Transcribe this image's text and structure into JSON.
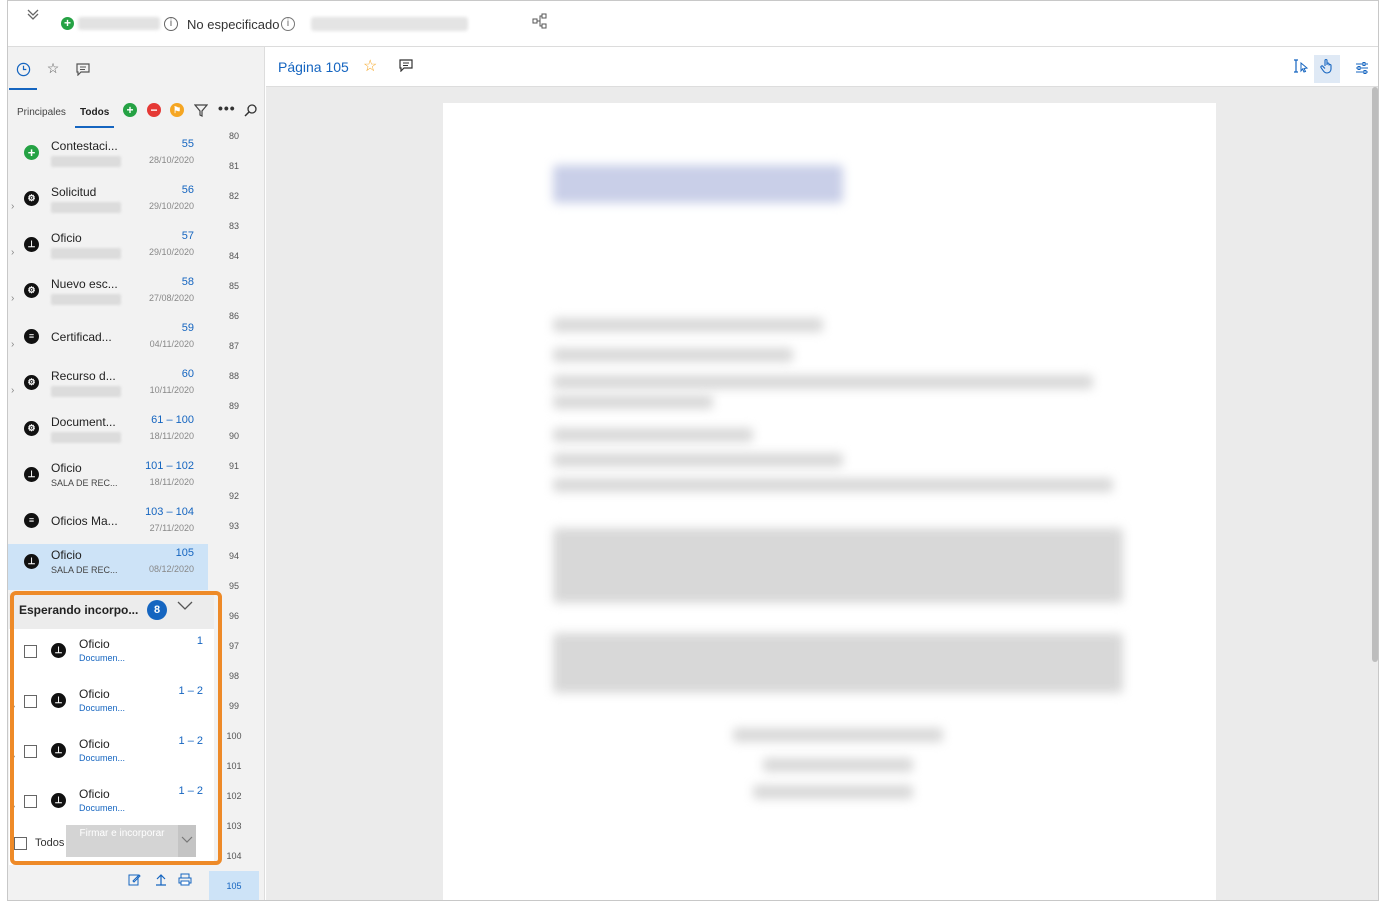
{
  "topbar": {
    "collapse_icon": "chevron-double-down-icon",
    "status_icon": "plus-circle-icon",
    "no_especificado": "No especificado",
    "info_icon": "info-icon",
    "hierarchy_icon": "hierarchy-icon"
  },
  "sidebar": {
    "tabs": [
      "clock-icon",
      "star-icon",
      "comment-icon"
    ],
    "filter_tabs": {
      "principales": "Principales",
      "todos": "Todos"
    },
    "documents": [
      {
        "title": "Contestaci...",
        "pages": "55",
        "date": "28/10/2020",
        "icon": "plus-circle-icon",
        "sub": ""
      },
      {
        "title": "Solicitud",
        "pages": "56",
        "date": "29/10/2020",
        "icon": "document-gear-icon",
        "sub": ""
      },
      {
        "title": "Oficio",
        "pages": "57",
        "date": "29/10/2020",
        "icon": "stamp-icon",
        "sub": ""
      },
      {
        "title": "Nuevo esc...",
        "pages": "58",
        "date": "27/08/2020",
        "icon": "document-gear-icon",
        "sub": ""
      },
      {
        "title": "Certificad...",
        "pages": "59",
        "date": "04/11/2020",
        "icon": "certificate-icon",
        "sub": ""
      },
      {
        "title": "Recurso d...",
        "pages": "60",
        "date": "10/11/2020",
        "icon": "document-gear-icon",
        "sub": ""
      },
      {
        "title": "Document...",
        "pages": "61 – 100",
        "date": "18/11/2020",
        "icon": "document-gear-icon",
        "sub": ""
      },
      {
        "title": "Oficio",
        "pages": "101 – 102",
        "date": "18/11/2020",
        "icon": "stamp-icon",
        "sub": "SALA DE REC..."
      },
      {
        "title": "Oficios Ma...",
        "pages": "103 – 104",
        "date": "27/11/2020",
        "icon": "certificate-icon",
        "sub": ""
      },
      {
        "title": "Oficio",
        "pages": "105",
        "date": "08/12/2020",
        "icon": "stamp-icon",
        "sub": "SALA DE REC..."
      }
    ],
    "page_numbers": [
      "80",
      "81",
      "82",
      "83",
      "84",
      "85",
      "86",
      "87",
      "88",
      "89",
      "90",
      "91",
      "92",
      "93",
      "94",
      "95",
      "96",
      "97",
      "98",
      "99",
      "100",
      "101",
      "102",
      "103",
      "104",
      "105"
    ],
    "waiting": {
      "title": "Esperando incorpo...",
      "count": "8",
      "items": [
        {
          "title": "Oficio",
          "sub": "Documen...",
          "pages": "1"
        },
        {
          "title": "Oficio",
          "sub": "Documen...",
          "pages": "1 – 2"
        },
        {
          "title": "Oficio",
          "sub": "Documen...",
          "pages": "1 – 2"
        },
        {
          "title": "Oficio",
          "sub": "Documen...",
          "pages": "1 – 2"
        }
      ],
      "all_label": "Todos",
      "sign_button": "Firmar e incorporar"
    },
    "bottom_tools": [
      "edit-icon",
      "upload-icon",
      "print-icon"
    ]
  },
  "viewer": {
    "page_label": "Página 105",
    "tools": [
      "text-select-icon",
      "hand-pointer-icon",
      "settings-sliders-icon"
    ],
    "accent": "#1565c0",
    "highlight": "#ee8a28"
  }
}
